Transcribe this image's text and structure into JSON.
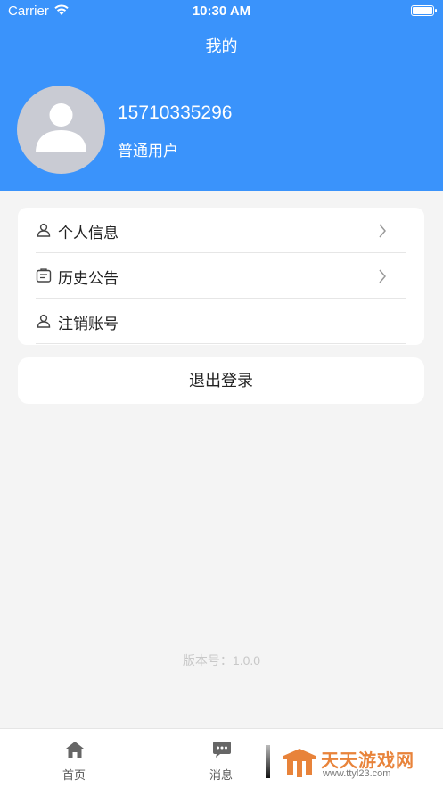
{
  "status_bar": {
    "carrier": "Carrier",
    "time": "10:30 AM"
  },
  "header": {
    "title": "我的"
  },
  "profile": {
    "phone": "15710335296",
    "user_type": "普通用户"
  },
  "menu": {
    "items": [
      {
        "label": "个人信息",
        "icon": "user-icon",
        "has_chevron": true
      },
      {
        "label": "历史公告",
        "icon": "announcement-icon",
        "has_chevron": true
      },
      {
        "label": "注销账号",
        "icon": "user-icon",
        "has_chevron": false
      }
    ]
  },
  "logout": {
    "label": "退出登录"
  },
  "version": {
    "text": "版本号：1.0.0"
  },
  "tabbar": {
    "tabs": [
      {
        "label": "首页",
        "icon": "home-icon"
      },
      {
        "label": "消息",
        "icon": "message-icon"
      }
    ]
  },
  "watermark": {
    "title": "天天游戏网",
    "url": "www.ttyl23.com"
  },
  "colors": {
    "primary": "#3a93fb",
    "background": "#f4f4f4",
    "watermark": "#e8833a"
  }
}
